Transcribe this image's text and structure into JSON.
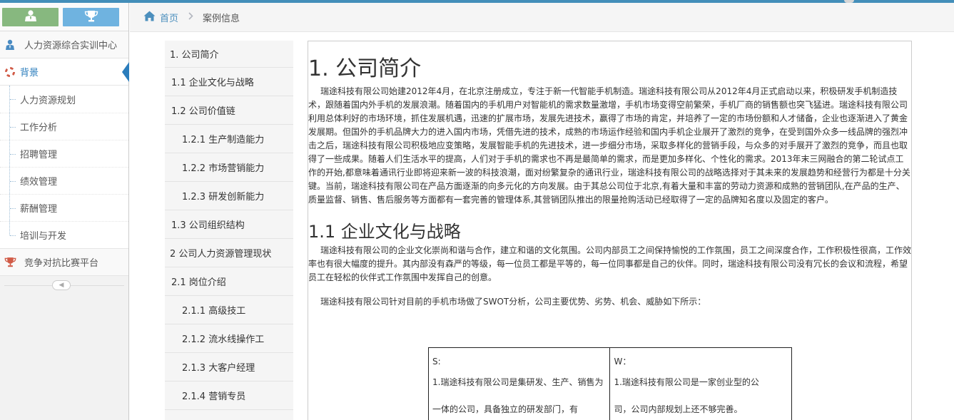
{
  "sidebar": {
    "shortcuts": [
      {
        "icon": "user-icon",
        "color": "#87b87f"
      },
      {
        "icon": "trophy-icon",
        "color": "#6fb3e0"
      }
    ],
    "center_label": "人力资源综合实训中心",
    "active_label": "背景",
    "sub_items": [
      "人力资源规划",
      "工作分析",
      "招聘管理",
      "绩效管理",
      "薪酬管理",
      "培训与开发"
    ],
    "competition_label": "竞争对抗比赛平台"
  },
  "breadcrumb": {
    "home": "首页",
    "current": "案例信息"
  },
  "toc": [
    "1. 公司简介",
    "1.1 企业文化与战略",
    "1.2 公司价值链",
    "1.2.1 生产制造能力",
    "1.2.2 市场营销能力",
    "1.2.3 研发创新能力",
    "1.3 公司组织结构",
    "2 公司人力资源管理现状",
    "2.1 岗位介绍",
    "2.1.1 高级技工",
    "2.1.2 流水线操作工",
    "2.1.3 大客户经理",
    "2.1.4 营销专员"
  ],
  "document": {
    "h1": "1. 公司简介",
    "intro": "瑞途科技有限公司始建2012年4月，在北京注册成立，专注于新一代智能手机制造。瑞途科技有限公司从2012年4月正式启动以来，积极研发手机制造技术，跟随着国内外手机的发展浪潮。随着国内的手机用户对智能机的需求数量激增，手机市场变得空前繁荣，手机厂商的销售额也突飞猛进。瑞途科技有限公司利用总体利好的市场环境，抓住发展机遇，迅速的扩展市场，发展先进技术，赢得了市场的肯定，并培养了一定的市场份额和人才储备，企业也逐渐进入了黄金发展期。但国外的手机品牌大力的进入国内市场，凭借先进的技术，成熟的市场运作经验和国内手机企业展开了激烈的竞争，在受到国外众多一线品牌的强烈冲击之后，瑞途科技有限公司积极地应变策略，发展智能手机的先进技术，进一步细分市场，采取多样化的营销手段，与众多的对手展开了激烈的竞争，而且也取得了一些成果。随着人们生活水平的提高，人们对于手机的需求也不再是最简单的需求，而是更加多样化、个性化的需求。2013年末三网融合的第二轮试点工作的开始,都意味着通讯行业即将迎来新一波的科技浪潮，面对纷繁复杂的通讯行业，瑞途科技有限公司的战略选择对于其未来的发展趋势和经营行为都是十分关键。当前，瑞途科技有限公司在产品方面逐渐的向多元化的方向发展。由于其总公司位于北京,有着大量和丰富的劳动力资源和成熟的营销团队,在产品的生产、质量监督、销售、售后服务等方面都有一套完善的管理体系,其营销团队推出的限量抢购活动已经取得了一定的品牌知名度以及固定的客户。",
    "h2": "1.1 企业文化与战略",
    "culture": "瑞途科技有限公司的企业文化崇尚和谐与合作，建立和谐的文化氛围。公司内部员工之间保持愉悦的工作氛围，员工之间深度合作，工作积极性很高，工作效率也有很大幅度的提升。其内部没有森严的等级，每一位员工都是平等的，每一位同事都是自己的伙伴。同时，瑞途科技有限公司没有冗长的会议和流程，希望员工在轻松的伙伴式工作氛围中发挥自己的创意。",
    "swot_intro": "瑞途科技有限公司针对目前的手机市场做了SWOT分析，公司主要优势、劣势、机会、威胁如下所示：",
    "swot": {
      "s_head": "S:",
      "s_text": "1.瑞途科技有限公司是集研发、生产、销售为一体的公司，具备独立的研发部门，有",
      "w_head": "W：",
      "w_text": "1.瑞途科技有限公司是一家创业型的公司，公司内部规划上还不够完善。"
    }
  },
  "colors": {
    "accent": "#438eb9",
    "link": "#4c8fbd",
    "active_arrow": "#2b7dbc",
    "trophy_red": "#d15b47"
  }
}
